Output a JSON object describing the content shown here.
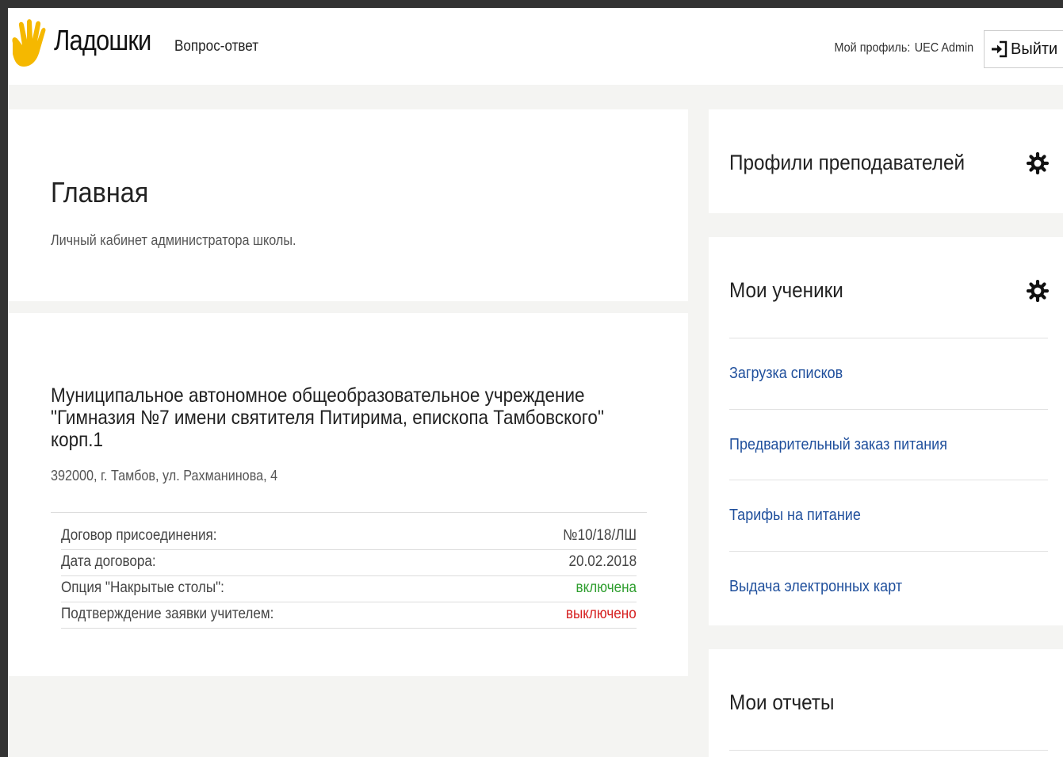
{
  "header": {
    "logo_text": "Ладошки",
    "nav_qa": "Вопрос-ответ",
    "profile_label": "Мой профиль:",
    "profile_user": "UEC Admin",
    "logout_label": "Выйти",
    "logo_color": "#f5b800"
  },
  "main": {
    "title": "Главная",
    "subtitle": "Личный кабинет администратора школы."
  },
  "school": {
    "name": "Муниципальное автономное общеобразовательное учреждение \"Гимназия №7 имени святителя Питирима, епископа Тамбовского\" корп.1",
    "address": "392000, г. Тамбов, ул. Рахманинова, 4",
    "rows": [
      {
        "label": "Договор присоединения:",
        "value": "№10/18/ЛШ",
        "color": "#444444"
      },
      {
        "label": "Дата договора:",
        "value": "20.02.2018",
        "color": "#444444"
      },
      {
        "label": "Опция \"Накрытые столы\":",
        "value": "включена",
        "color": "#2e9e2e"
      },
      {
        "label": "Подтверждение заявки учителем:",
        "value": "выключено",
        "color": "#d62020"
      }
    ]
  },
  "sidebar": {
    "teachers_title": "Профили преподавателей",
    "students_title": "Мои ученики",
    "students_links": [
      "Загрузка списков",
      "Предварительный заказ питания",
      "Тарифы на питание",
      "Выдача электронных карт"
    ],
    "reports_title": "Мои отчеты",
    "link_color": "#1f4f9c"
  }
}
